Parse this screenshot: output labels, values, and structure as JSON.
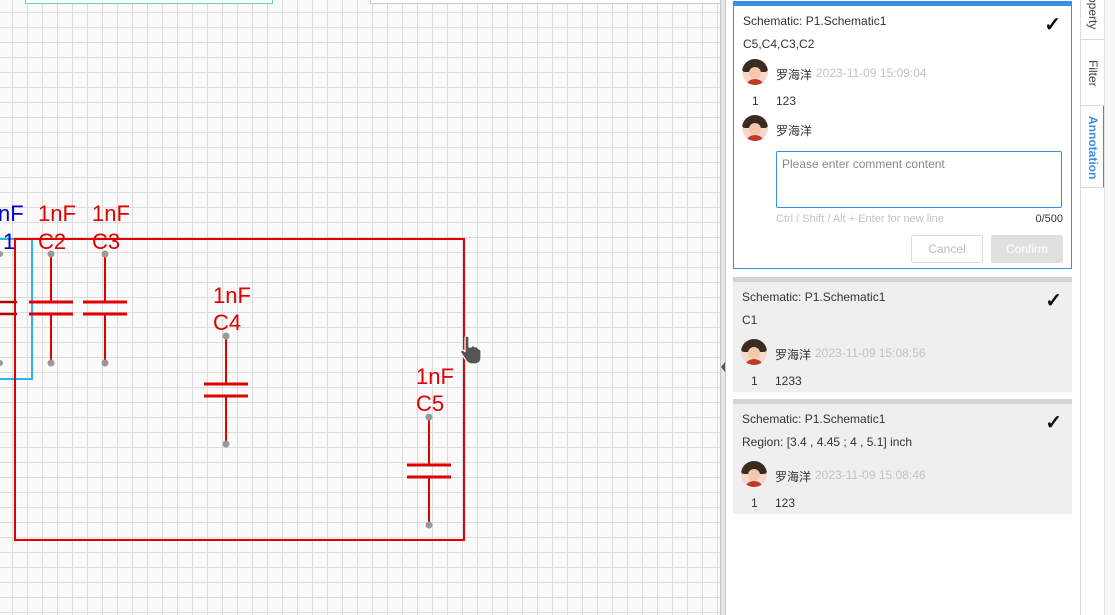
{
  "schematic": {
    "labels": [
      {
        "id": "left-value",
        "text": "nF",
        "color": "blue"
      },
      {
        "id": "left-ref",
        "text": "1",
        "color": "blue"
      },
      {
        "id": "c2-value",
        "text": "1nF"
      },
      {
        "id": "c2-ref",
        "text": "C2"
      },
      {
        "id": "c3-value",
        "text": "1nF"
      },
      {
        "id": "c3-ref",
        "text": "C3"
      },
      {
        "id": "c4-value",
        "text": "1nF"
      },
      {
        "id": "c4-ref",
        "text": "C4"
      },
      {
        "id": "c5-value",
        "text": "1nF"
      },
      {
        "id": "c5-ref",
        "text": "C5"
      }
    ],
    "colors": {
      "wire": "#e00000",
      "selection": "#29b6e8",
      "pin": "#999999"
    }
  },
  "panel": {
    "cards": [
      {
        "title": "Schematic: P1.Schematic1",
        "refs": "C5,C4,C3,C2",
        "check": "✓",
        "user": "罗海洋",
        "time": "2023-11-09 15:09:04",
        "comment_num": "1",
        "comment_text": "123",
        "reply_user": "罗海洋",
        "input_placeholder": "Please enter comment content",
        "hint": "Ctrl / Shift / Alt + Enter for new line",
        "counter": "0/500",
        "cancel_label": "Cancel",
        "confirm_label": "Confirm"
      },
      {
        "title": "Schematic: P1.Schematic1",
        "refs": "C1",
        "check": "✓",
        "user": "罗海洋",
        "time": "2023-11-09 15:08:56",
        "comment_num": "1",
        "comment_text": "1233"
      },
      {
        "title": "Schematic: P1.Schematic1",
        "refs": "Region: [3.4 , 4.45 ; 4 , 5.1] inch",
        "check": "✓",
        "user": "罗海洋",
        "time": "2023-11-09 15:08:46",
        "comment_num": "1",
        "comment_text": "123"
      }
    ]
  },
  "tabs": [
    {
      "label": "operty",
      "active": false
    },
    {
      "label": "Filter",
      "active": false
    },
    {
      "label": "Annotation",
      "active": true
    }
  ],
  "accent": "#3a8ee6"
}
